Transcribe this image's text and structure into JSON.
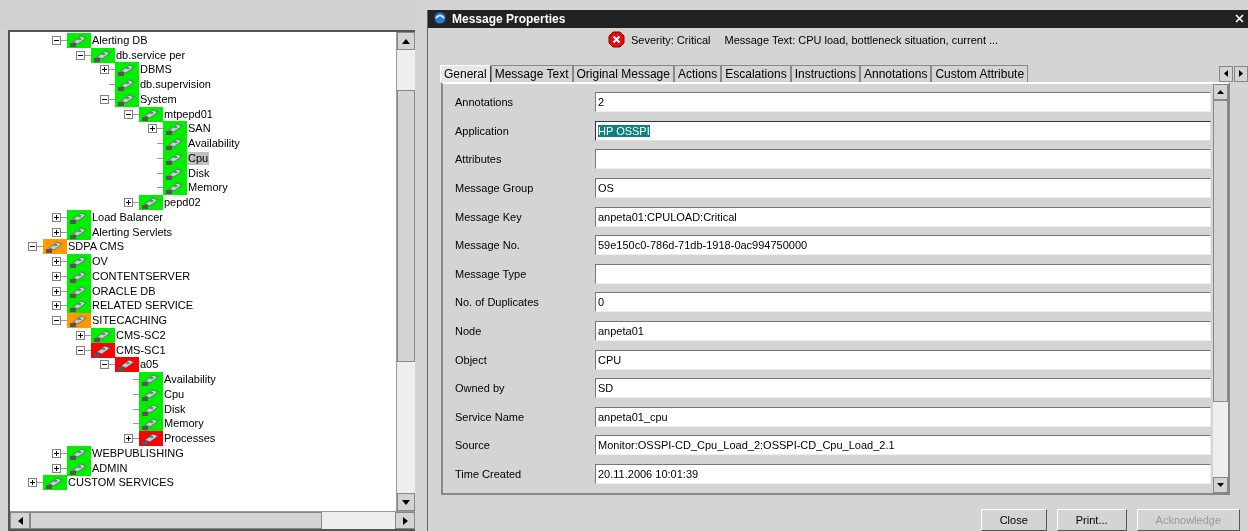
{
  "tree": {
    "continued_items": [
      {
        "label": "Alerting DB",
        "color": "#00ee00",
        "expanded": true,
        "selected": false,
        "children": [
          {
            "label": "db.service per",
            "color": "#00ee00",
            "expanded": true,
            "selected": false,
            "children": [
              {
                "label": "DBMS",
                "color": "#00ee00",
                "expanded": false,
                "selected": false
              },
              {
                "label": "db.supervision",
                "color": "#00ee00",
                "selected": false
              },
              {
                "label": "System",
                "color": "#00ee00",
                "expanded": true,
                "selected": false,
                "children": [
                  {
                    "label": "mtpepd01",
                    "color": "#00ee00",
                    "expanded": true,
                    "selected": false,
                    "children": [
                      {
                        "label": "SAN",
                        "color": "#00ee00",
                        "expanded": false,
                        "selected": false
                      },
                      {
                        "label": "Availability",
                        "color": "#00ee00",
                        "selected": false
                      },
                      {
                        "label": "Cpu",
                        "color": "#00ee00",
                        "selected": true
                      },
                      {
                        "label": "Disk",
                        "color": "#00ee00",
                        "selected": false
                      },
                      {
                        "label": "Memory",
                        "color": "#00ee00",
                        "selected": false
                      }
                    ]
                  },
                  {
                    "label": "pepd02",
                    "color": "#00ee00",
                    "expanded": false,
                    "selected": false
                  }
                ]
              }
            ]
          }
        ]
      },
      {
        "label": "Load Balancer",
        "color": "#00ee00",
        "expanded": false,
        "selected": false
      },
      {
        "label": "Alerting Servlets",
        "color": "#00ee00",
        "expanded": false,
        "selected": false
      }
    ],
    "items": [
      {
        "label": "SDPA CMS",
        "color": "#ff9900",
        "expanded": true,
        "selected": false,
        "children": [
          {
            "label": "OV",
            "color": "#00ee00",
            "expanded": false,
            "selected": false
          },
          {
            "label": "CONTENTSERVER",
            "color": "#00ee00",
            "expanded": false,
            "selected": false
          },
          {
            "label": "ORACLE DB",
            "color": "#00ee00",
            "expanded": false,
            "selected": false
          },
          {
            "label": "RELATED SERVICE",
            "color": "#00ee00",
            "expanded": false,
            "selected": false
          },
          {
            "label": "SITECACHING",
            "color": "#ff9900",
            "expanded": true,
            "selected": false,
            "children": [
              {
                "label": "CMS-SC2",
                "color": "#00ee00",
                "expanded": false,
                "selected": false
              },
              {
                "label": "CMS-SC1",
                "color": "#ff0000",
                "expanded": true,
                "selected": false,
                "children": [
                  {
                    "label": "a05",
                    "color": "#ff0000",
                    "expanded": true,
                    "selected": false,
                    "children": [
                      {
                        "label": "Availability",
                        "color": "#00ee00",
                        "selected": false
                      },
                      {
                        "label": "Cpu",
                        "color": "#00ee00",
                        "selected": false
                      },
                      {
                        "label": "Disk",
                        "color": "#00ee00",
                        "selected": false
                      },
                      {
                        "label": "Memory",
                        "color": "#00ee00",
                        "selected": false
                      },
                      {
                        "label": "Processes",
                        "color": "#ff0000",
                        "expanded": false,
                        "selected": false
                      }
                    ]
                  }
                ]
              }
            ]
          },
          {
            "label": "WEBPUBLISHING",
            "color": "#00ee00",
            "expanded": false,
            "selected": false
          },
          {
            "label": "ADMIN",
            "color": "#00ee00",
            "expanded": false,
            "selected": false
          }
        ]
      },
      {
        "label": "CUSTOM SERVICES",
        "color": "#00ee00",
        "expanded": false,
        "selected": false
      }
    ]
  },
  "dialog": {
    "title": "Message Properties",
    "severity": "Severity: Critical",
    "message_text": "Message Text: CPU load, bottleneck situation, current ...",
    "tabs": [
      {
        "label": "General",
        "selected": true
      },
      {
        "label": "Message Text",
        "selected": false
      },
      {
        "label": "Original Message",
        "selected": false
      },
      {
        "label": "Actions",
        "selected": false
      },
      {
        "label": "Escalations",
        "selected": false
      },
      {
        "label": "Instructions",
        "selected": false
      },
      {
        "label": "Annotations",
        "selected": false
      },
      {
        "label": "Custom Attribute",
        "selected": false
      }
    ],
    "fields": [
      {
        "label": "Annotations",
        "value": "2",
        "highlighted": false
      },
      {
        "label": "Application",
        "value": "HP OSSPI",
        "highlighted": true
      },
      {
        "label": "Attributes",
        "highlighted": false
      },
      {
        "label": "Message Group",
        "value": "OS",
        "highlighted": false
      },
      {
        "label": "Message Key",
        "value": "anpeta01:CPULOAD:Critical",
        "highlighted": false
      },
      {
        "label": "Message No.",
        "value": "59e150c0-786d-71db-1918-0ac994750000",
        "highlighted": false
      },
      {
        "label": "Message Type",
        "highlighted": false
      },
      {
        "label": "No. of Duplicates",
        "value": "0",
        "highlighted": false
      },
      {
        "label": "Node",
        "value": "anpeta01",
        "highlighted": false
      },
      {
        "label": "Object",
        "value": "CPU",
        "highlighted": false
      },
      {
        "label": "Owned by",
        "value": "SD",
        "highlighted": false
      },
      {
        "label": "Service Name",
        "value": "anpeta01_cpu",
        "highlighted": false
      },
      {
        "label": "Source",
        "value": "Monitor:OSSPI-CD_Cpu_Load_2:OSSPI-CD_Cpu_Load_2.1",
        "highlighted": false
      },
      {
        "label": "Time Created",
        "value": "20.11.2006 10:01:39",
        "highlighted": false
      }
    ],
    "buttons": [
      {
        "label": "Close",
        "disabled": false
      },
      {
        "label": "Print...",
        "disabled": false
      },
      {
        "label": "Acknowledge",
        "disabled": true
      }
    ]
  }
}
